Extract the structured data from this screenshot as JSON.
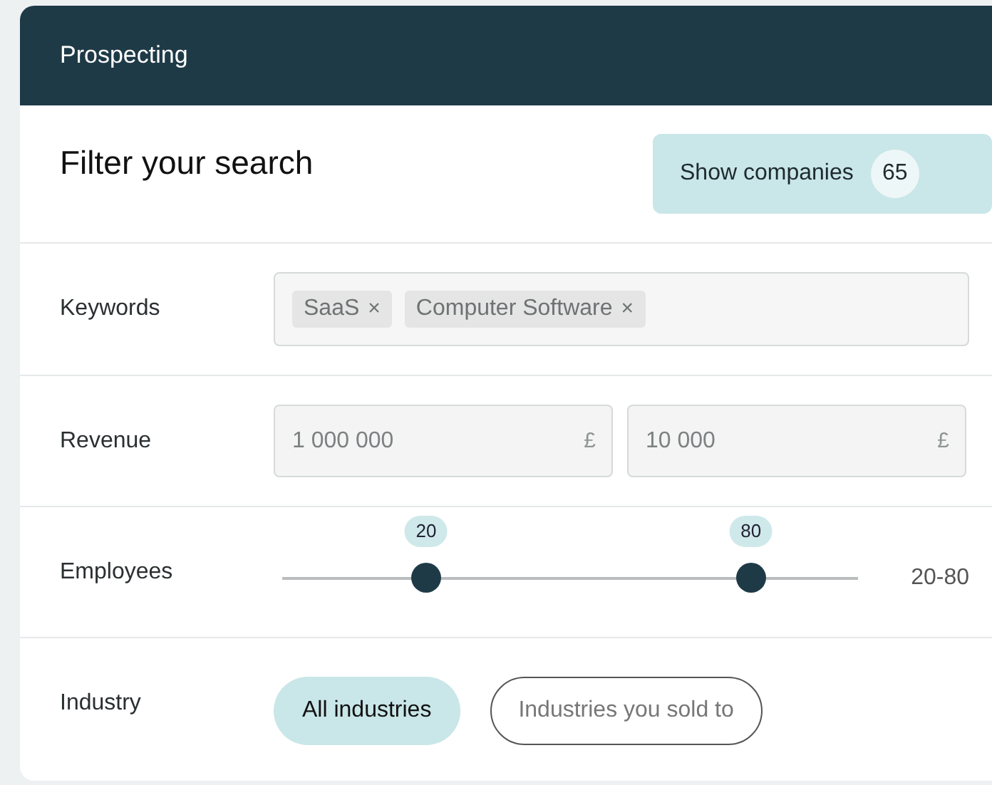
{
  "window": {
    "title": "Prospecting"
  },
  "heading": "Filter your search",
  "show_button": {
    "label": "Show companies",
    "count": "65"
  },
  "keywords": {
    "label": "Keywords",
    "tags": [
      {
        "text": "SaaS",
        "remove": "×"
      },
      {
        "text": "Computer Software",
        "remove": "×"
      }
    ]
  },
  "revenue": {
    "label": "Revenue",
    "fields": [
      {
        "placeholder": "1 000 000",
        "currency": "£"
      },
      {
        "placeholder": "10 000",
        "currency": "£"
      }
    ]
  },
  "employees": {
    "label": "Employees",
    "thumbs": [
      {
        "value": "20",
        "level": 0.25
      },
      {
        "value": "80",
        "level": 0.814
      }
    ],
    "reading": "20-80"
  },
  "industry": {
    "label": "Industry",
    "options": [
      {
        "label": "All industries",
        "selected": true
      },
      {
        "label": "Industries you sold to",
        "selected": false
      }
    ]
  }
}
